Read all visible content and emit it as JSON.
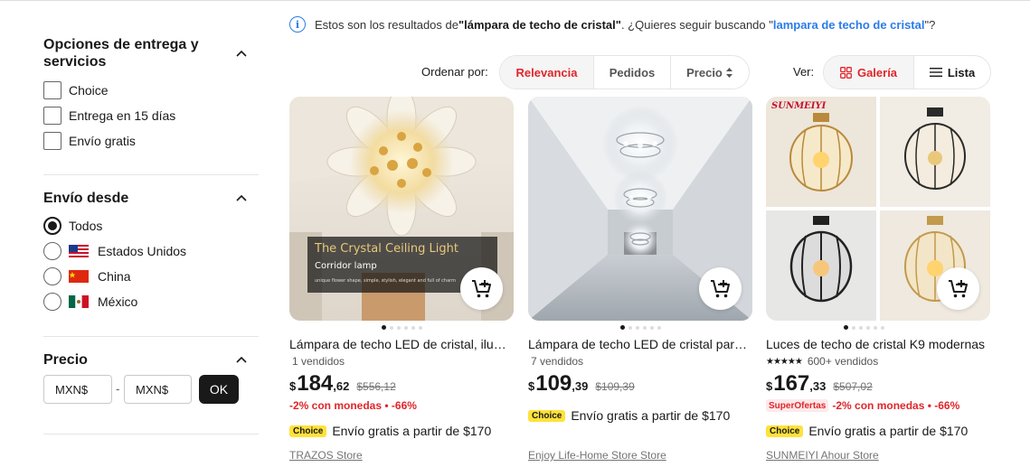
{
  "filters": {
    "delivery": {
      "title": "Opciones de entrega y servicios",
      "options": [
        "Choice",
        "Entrega en 15 días",
        "Envío gratis"
      ]
    },
    "ship_from": {
      "title": "Envío desde",
      "options": [
        "Todos",
        "Estados Unidos",
        "China",
        "México"
      ],
      "selected": "Todos"
    },
    "price": {
      "title": "Precio",
      "min_placeholder": "MXN$",
      "max_placeholder": "MXN$",
      "separator": "-",
      "ok_label": "OK"
    }
  },
  "search_notice": {
    "prefix": "Estos son los resultados de ",
    "query": "\"lámpara de techo de cristal\"",
    "middle": ". ¿Quieres seguir buscando \"",
    "suggestion": "lampara de techo de cristal",
    "suffix": "\"?"
  },
  "sort": {
    "label": "Ordenar por:",
    "options": [
      "Relevancia",
      "Pedidos",
      "Precio"
    ],
    "active": "Relevancia"
  },
  "view": {
    "label": "Ver:",
    "options": [
      "Galería",
      "Lista"
    ],
    "active": "Galería"
  },
  "products": [
    {
      "title": "Lámpara de techo LED de cristal, iluminación moderna",
      "sold": "1 vendidos",
      "currency": "$",
      "price_int": "184",
      "price_dec": ",62",
      "price_old": "$556,12",
      "promo": "-2% con monedas • -66%",
      "choice_badge": "Choice",
      "shipping": "Envío gratis a partir de $170",
      "store": "TRAZOS Store",
      "image_text_1": "The Crystal Ceiling Light",
      "image_text_2": "Corridor lamp",
      "image_text_3": "unique flower shape, simple, stylish, elegant and full of charm"
    },
    {
      "title": "Lámpara de techo LED de cristal para pasillo",
      "sold": "7 vendidos",
      "currency": "$",
      "price_int": "109",
      "price_dec": ",39",
      "price_old": "$109,39",
      "choice_badge": "Choice",
      "shipping": "Envío gratis a partir de $170",
      "store": "Enjoy Life-Home Store Store"
    },
    {
      "title": "Luces de techo de cristal K9 modernas",
      "rating_stars": "★★★★★",
      "sold": "600+ vendidos",
      "currency": "$",
      "price_int": "167",
      "price_dec": ",33",
      "price_old": "$507,02",
      "super_badge": "SuperOfertas",
      "promo": "-2% con monedas • -66%",
      "choice_badge": "Choice",
      "shipping": "Envío gratis a partir de $170",
      "store": "SUNMEIYI Ahour Store",
      "image_brand": "SUNMEIYI"
    }
  ]
}
